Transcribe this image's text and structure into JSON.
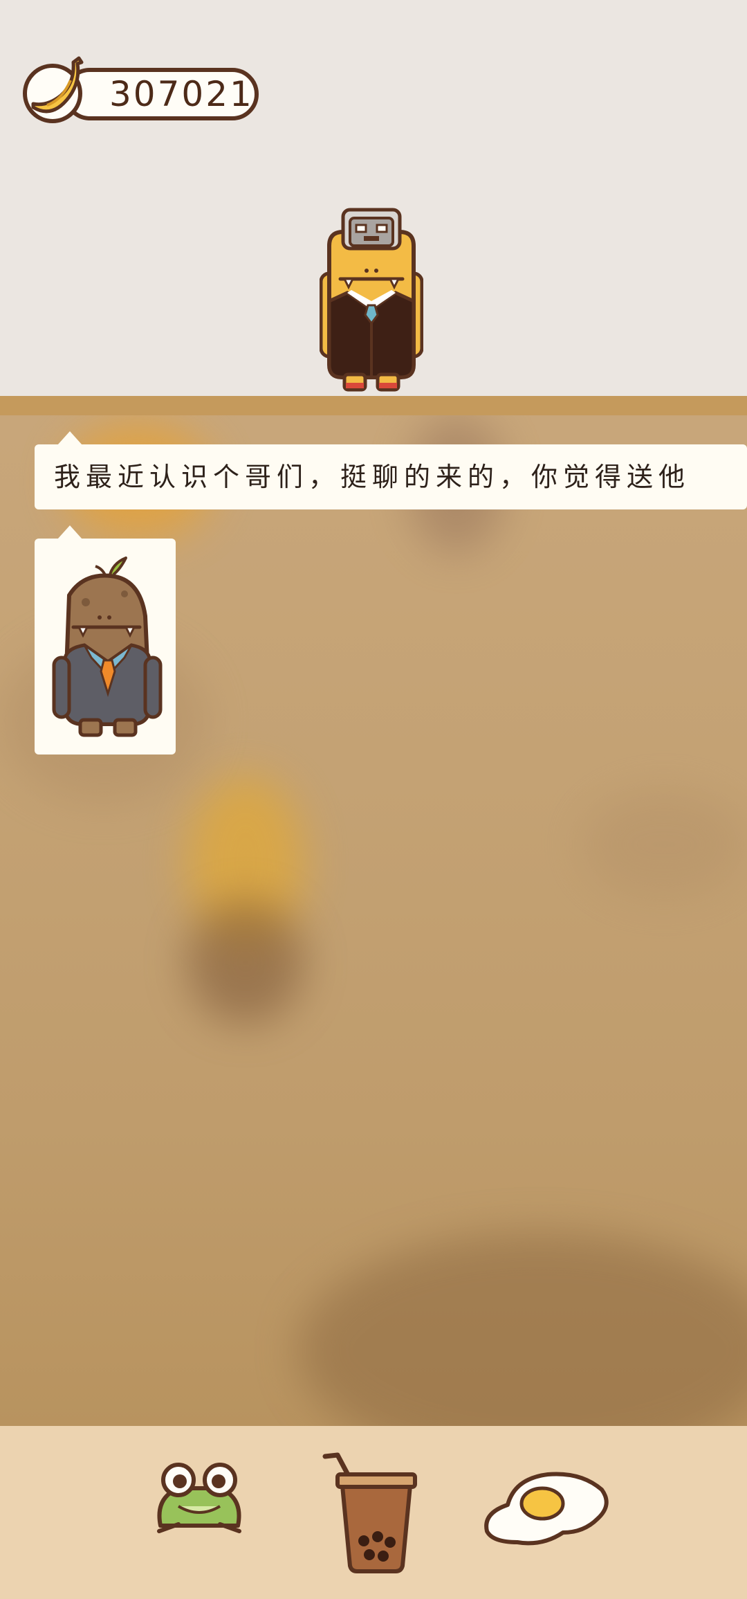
{
  "hud": {
    "coin_icon": "banana-icon",
    "coin_count": "307021"
  },
  "dialog": {
    "message": "我最近认识个哥们，挺聊的来的，你觉得送他",
    "attachment": "potato-character-in-suit"
  },
  "dock": {
    "items": [
      {
        "icon": "frog-icon"
      },
      {
        "icon": "bubble-tea-icon"
      },
      {
        "icon": "fried-egg-icon"
      }
    ]
  },
  "colors": {
    "outline": "#5a3320",
    "shelf": "#c59a5c",
    "dock": "#ecd3b0",
    "bubble": "#fffcf3"
  }
}
